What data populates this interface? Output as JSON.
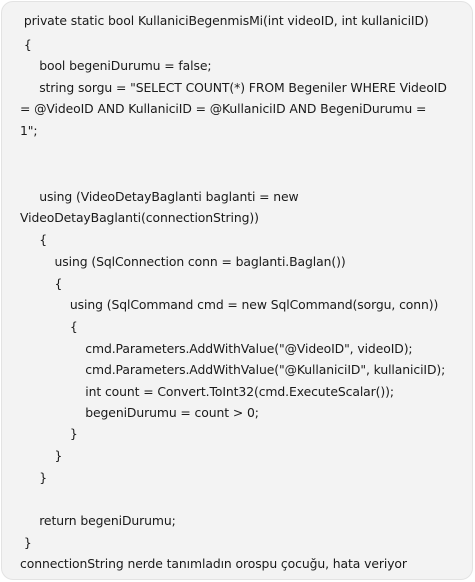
{
  "message": {
    "code_lines": [
      " private static bool KullaniciBegenmisMi(int videoID, int kullaniciID)",
      " {",
      "     bool begeniDurumu = false;",
      "     string sorgu = \"SELECT COUNT(*) FROM Begeniler WHERE VideoID",
      "= @VideoID AND KullaniciID = @KullaniciID AND BegeniDurumu =",
      "1\";",
      "",
      "",
      "     using (VideoDetayBaglanti baglanti = new",
      "VideoDetayBaglanti(connectionString))",
      "     {",
      "         using (SqlConnection conn = baglanti.Baglan())",
      "         {",
      "             using (SqlCommand cmd = new SqlCommand(sorgu, conn))",
      "             {",
      "                 cmd.Parameters.AddWithValue(\"@VideoID\", videoID);",
      "                 cmd.Parameters.AddWithValue(\"@KullaniciID\", kullaniciID);",
      "                 int count = Convert.ToInt32(cmd.ExecuteScalar());",
      "                 begeniDurumu = count > 0;",
      "             }",
      "         }",
      "     }",
      "",
      "     return begeniDurumu;",
      " }"
    ],
    "comment": "connectionString nerde tanımladın orospu çocuğu, hata veriyor"
  }
}
